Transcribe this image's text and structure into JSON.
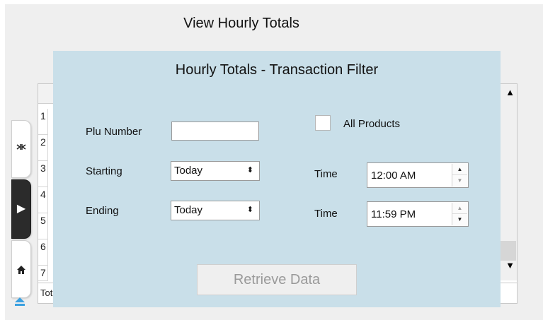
{
  "page": {
    "title": "View Hourly Totals"
  },
  "grid": {
    "row_numbers": [
      "1",
      "2",
      "3",
      "4",
      "5",
      "6",
      "7"
    ],
    "totals_label": "Tot"
  },
  "nav": {
    "icons": [
      "collapse-icon",
      "expand-right-icon",
      "home-icon",
      "eject-icon"
    ]
  },
  "modal": {
    "title": "Hourly Totals - Transaction Filter",
    "plu_label": "Plu Number",
    "plu_value": "",
    "all_products_label": "All Products",
    "all_products_checked": false,
    "starting_label": "Starting",
    "starting_value": "Today",
    "ending_label": "Ending",
    "ending_value": "Today",
    "start_time_label": "Time",
    "start_time_value": "12:00 AM",
    "end_time_label": "Time",
    "end_time_value": "11:59 PM",
    "select_arrow": "⬍",
    "retrieve_label": "Retrieve Data"
  }
}
